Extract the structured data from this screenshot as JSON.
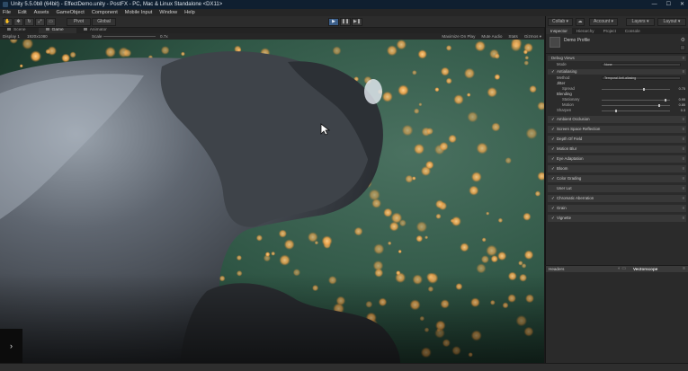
{
  "window": {
    "title": "Unity 5.5.0b8 (64bit) - EffectDemo.unity - PostFX - PC, Mac & Linux Standalone <DX11>",
    "controls": [
      "—",
      "☐",
      "✕"
    ]
  },
  "menu": [
    "File",
    "Edit",
    "Assets",
    "GameObject",
    "Component",
    "Mobile Input",
    "Window",
    "Help"
  ],
  "toolbar": {
    "pivot_label": "Pivot",
    "space_label": "Global",
    "collab_label": "Collab ▾",
    "account_label": "Account ▾",
    "layers_label": "Layers ▾",
    "layout_label": "Layout ▾"
  },
  "scene_tabs": [
    {
      "label": "Scene",
      "active": false
    },
    {
      "label": "Game",
      "active": true
    },
    {
      "label": "Animator",
      "active": false
    }
  ],
  "game_bar": {
    "display": "Display 1",
    "resolution": "1920x1080",
    "scale_label": "Scale",
    "scale_value": "0.7x",
    "options": [
      "Maximize On Play",
      "Mute Audio",
      "Stats",
      "Gizmos ▾"
    ]
  },
  "inspector": {
    "tabs": [
      {
        "label": "Inspector",
        "active": true
      },
      {
        "label": "Hierarchy",
        "active": false
      },
      {
        "label": "Project",
        "active": false
      },
      {
        "label": "Console",
        "active": false
      }
    ],
    "profile_title": "Demo Profile",
    "debug_views_label": "Debug Views",
    "mode_label": "Mode",
    "mode_value": "None",
    "antialiasing_label": "Antialiasing",
    "method_label": "Method",
    "method_value": "Temporal Anti-aliasing",
    "jitter_label": "Jitter",
    "spread_label": "Spread",
    "spread_value": "0.75",
    "spread_level": 0.62,
    "blending_label": "Blending",
    "stationary_label": "Stationary",
    "stationary_value": "0.95",
    "stationary_level": 0.95,
    "motion_label": "Motion",
    "motion_value": "0.85",
    "motion_level": 0.85,
    "sharpen_label": "Sharpen",
    "sharpen_value": "0.3",
    "sharpen_level": 0.2,
    "effects": [
      "Ambient Occlusion",
      "Screen Space Reflection",
      "Depth Of Field",
      "Motion Blur",
      "Eye Adaptation",
      "Bloom",
      "Color Grading",
      "User Lut",
      "Chromatic Aberration",
      "Grain",
      "Vignette"
    ],
    "effects_enabled": [
      true,
      true,
      true,
      true,
      true,
      true,
      true,
      false,
      true,
      true,
      true
    ]
  },
  "bottom_panel": {
    "left_tab": "Headers",
    "right_tab": "Vectorscope"
  },
  "icons": {
    "play": "play-icon",
    "gear": "gear-icon",
    "check": "check-icon"
  },
  "colors": {
    "title_bar": "#0f1f30",
    "play_active": "#3c5f8a",
    "viewport_bg": "#345a49",
    "bokeh": "#f2a64a"
  }
}
